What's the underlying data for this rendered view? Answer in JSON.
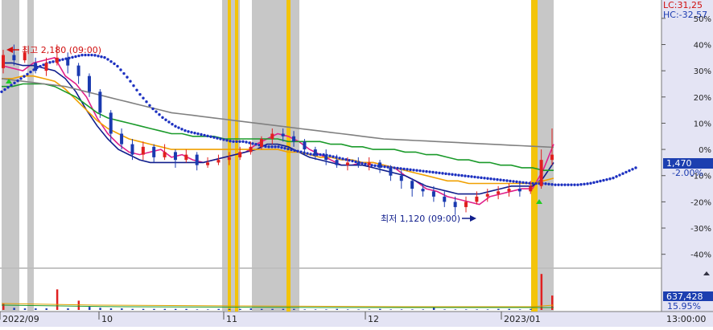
{
  "chart_data": {
    "type": "candlestick",
    "indicators": {
      "lc": "LC:31,25",
      "hc": "HC:-32,57"
    },
    "annotations": {
      "high": "최고 2,180 (09:00)",
      "low": "최저 1,120 (09:00)"
    },
    "y_axis": {
      "unit": "%",
      "ticks": [
        {
          "value": 50,
          "label": "50%"
        },
        {
          "value": 40,
          "label": "40%"
        },
        {
          "value": 30,
          "label": "30%"
        },
        {
          "value": 20,
          "label": "20%"
        },
        {
          "value": 10,
          "label": "10%"
        },
        {
          "value": 0,
          "label": "0%"
        },
        {
          "value": -10,
          "label": "-10%"
        },
        {
          "value": -20,
          "label": "-20%"
        },
        {
          "value": -30,
          "label": "-30%"
        },
        {
          "value": -40,
          "label": "-40%"
        }
      ],
      "range": [
        -45,
        57
      ]
    },
    "current_price": {
      "label": "1,470",
      "pct_label": "-2.00%",
      "pct": -2.0
    },
    "volume": {
      "label": "637,428",
      "pct_label": "15.95%"
    },
    "x_axis": {
      "labels": [
        "2022/09",
        "10",
        "11",
        "12",
        "2023/01"
      ],
      "time_label": "13:00:00"
    },
    "series": [
      {
        "name": "ma5",
        "color": "#e0208a",
        "values": [
          32,
          31,
          30,
          33,
          34,
          35,
          28,
          25,
          20,
          12,
          6,
          2,
          -1,
          -2,
          -1,
          0,
          -3,
          -2,
          -4,
          -5,
          -4,
          -3,
          -2,
          -1,
          2,
          4,
          6,
          5,
          3,
          0,
          -2,
          -4,
          -6,
          -6,
          -5,
          -5,
          -6,
          -7,
          -10,
          -12,
          -15,
          -16,
          -18,
          -19,
          -20,
          -21,
          -18,
          -17,
          -16,
          -15,
          -15,
          -8,
          2
        ]
      },
      {
        "name": "ma20",
        "color": "#101e8c",
        "values": [
          33,
          33,
          32,
          32,
          31,
          30,
          27,
          22,
          15,
          9,
          4,
          0,
          -2,
          -4,
          -5,
          -5,
          -5,
          -5,
          -5,
          -5,
          -4,
          -3,
          -2,
          -1,
          0,
          2,
          2,
          1,
          -1,
          -3,
          -4,
          -5,
          -6,
          -6,
          -6,
          -7,
          -8,
          -9,
          -10,
          -12,
          -14,
          -15,
          -16,
          -17,
          -17,
          -17,
          -16,
          -15,
          -14,
          -14,
          -14,
          -11,
          -5
        ]
      },
      {
        "name": "ma60",
        "color": "#f0a000",
        "values": [
          27,
          27,
          28,
          28,
          27,
          26,
          23,
          19,
          15,
          11,
          8,
          6,
          4,
          3,
          2,
          1,
          0,
          0,
          0,
          0,
          0,
          0,
          0,
          0,
          0,
          0,
          0,
          -1,
          -1,
          -2,
          -3,
          -3,
          -4,
          -4,
          -5,
          -5,
          -6,
          -7,
          -8,
          -9,
          -10,
          -11,
          -12,
          -12,
          -13,
          -13,
          -13,
          -13,
          -13,
          -13,
          -13,
          -12,
          -11
        ]
      },
      {
        "name": "ma120",
        "color": "#1a9a2a",
        "values": [
          24,
          24,
          25,
          25,
          25,
          24,
          22,
          20,
          17,
          14,
          12,
          11,
          10,
          9,
          8,
          7,
          6,
          6,
          5,
          5,
          5,
          4,
          4,
          4,
          4,
          4,
          4,
          3,
          3,
          3,
          3,
          2,
          2,
          1,
          1,
          0,
          0,
          0,
          -1,
          -1,
          -2,
          -2,
          -3,
          -4,
          -4,
          -5,
          -5,
          -6,
          -6,
          -7,
          -7,
          -8,
          -8
        ]
      },
      {
        "name": "ma240",
        "color": "#808080",
        "values": [
          27,
          26.5,
          26,
          25.5,
          25,
          24.5,
          24,
          23,
          22,
          21,
          20,
          19,
          18,
          17,
          16,
          15,
          14,
          13.5,
          13,
          12.5,
          12,
          11.5,
          11,
          10.5,
          10,
          9.5,
          9,
          8.5,
          8,
          7.5,
          7,
          6.5,
          6,
          5.5,
          5,
          4.5,
          4,
          3.8,
          3.6,
          3.4,
          3.2,
          3,
          2.8,
          2.6,
          2.4,
          2.2,
          2,
          1.8,
          1.6,
          1.4,
          1.2,
          1,
          0.8
        ]
      },
      {
        "name": "trend",
        "color": "#1b2fc0",
        "values": [
          22,
          25,
          28,
          31,
          33,
          34,
          35,
          36,
          36,
          35,
          32,
          27,
          21,
          16,
          12,
          9,
          7,
          6,
          5,
          4,
          3,
          3,
          2,
          1,
          1,
          0,
          -1,
          -2,
          -2,
          -3,
          -4,
          -5,
          -6,
          -6.5,
          -7,
          -7.5,
          -8,
          -8.5,
          -9,
          -9.5,
          -10,
          -10.5,
          -11,
          -11.5,
          -12,
          -12.5,
          -13,
          -13,
          -13.5,
          -13.5,
          -13.5,
          -13,
          -12,
          -11,
          -9,
          -7
        ]
      }
    ],
    "candles": [
      {
        "o": 31,
        "c": 36,
        "h": 38,
        "l": 29
      },
      {
        "o": 36,
        "c": 34,
        "h": 40,
        "l": 32
      },
      {
        "o": 34,
        "c": 37,
        "h": 39,
        "l": 33
      },
      {
        "o": 33,
        "c": 30,
        "h": 35,
        "l": 29
      },
      {
        "o": 30,
        "c": 33,
        "h": 35,
        "l": 28
      },
      {
        "o": 33,
        "c": 35,
        "h": 40,
        "l": 32
      },
      {
        "o": 35,
        "c": 32,
        "h": 37,
        "l": 29
      },
      {
        "o": 32,
        "c": 28,
        "h": 33,
        "l": 25
      },
      {
        "o": 28,
        "c": 22,
        "h": 29,
        "l": 20
      },
      {
        "o": 22,
        "c": 14,
        "h": 23,
        "l": 12
      },
      {
        "o": 14,
        "c": 6,
        "h": 15,
        "l": 3
      },
      {
        "o": 6,
        "c": 2,
        "h": 8,
        "l": 0
      },
      {
        "o": 2,
        "c": -2,
        "h": 4,
        "l": -4
      },
      {
        "o": -2,
        "c": 1,
        "h": 3,
        "l": -4
      },
      {
        "o": 1,
        "c": -3,
        "h": 2,
        "l": -5
      },
      {
        "o": -3,
        "c": -1,
        "h": 2,
        "l": -4
      },
      {
        "o": -1,
        "c": -4,
        "h": 0,
        "l": -7
      },
      {
        "o": -4,
        "c": -2,
        "h": 0,
        "l": -5
      },
      {
        "o": -2,
        "c": -6,
        "h": -1,
        "l": -8
      },
      {
        "o": -6,
        "c": -5,
        "h": -3,
        "l": -7
      },
      {
        "o": -5,
        "c": -4,
        "h": -2,
        "l": -6
      },
      {
        "o": -4,
        "c": -3,
        "h": -1,
        "l": -6
      },
      {
        "o": -3,
        "c": -1,
        "h": 1,
        "l": -4
      },
      {
        "o": -1,
        "c": 1,
        "h": 3,
        "l": -2
      },
      {
        "o": 1,
        "c": 4,
        "h": 5,
        "l": 0
      },
      {
        "o": 4,
        "c": 6,
        "h": 8,
        "l": 2
      },
      {
        "o": 6,
        "c": 5,
        "h": 8,
        "l": 3
      },
      {
        "o": 5,
        "c": 3,
        "h": 7,
        "l": 1
      },
      {
        "o": 3,
        "c": 0,
        "h": 4,
        "l": -2
      },
      {
        "o": 0,
        "c": -2,
        "h": 1,
        "l": -4
      },
      {
        "o": -2,
        "c": -4,
        "h": 0,
        "l": -6
      },
      {
        "o": -4,
        "c": -6,
        "h": -2,
        "l": -7
      },
      {
        "o": -6,
        "c": -5,
        "h": -3,
        "l": -8
      },
      {
        "o": -5,
        "c": -6,
        "h": -3,
        "l": -7
      },
      {
        "o": -6,
        "c": -5,
        "h": -3,
        "l": -8
      },
      {
        "o": -5,
        "c": -7,
        "h": -4,
        "l": -9
      },
      {
        "o": -7,
        "c": -10,
        "h": -6,
        "l": -12
      },
      {
        "o": -10,
        "c": -12,
        "h": -8,
        "l": -15
      },
      {
        "o": -12,
        "c": -15,
        "h": -11,
        "l": -18
      },
      {
        "o": -15,
        "c": -16,
        "h": -13,
        "l": -18
      },
      {
        "o": -16,
        "c": -18,
        "h": -14,
        "l": -20
      },
      {
        "o": -18,
        "c": -20,
        "h": -16,
        "l": -22
      },
      {
        "o": -20,
        "c": -22,
        "h": -18,
        "l": -25
      },
      {
        "o": -22,
        "c": -20,
        "h": -18,
        "l": -24
      },
      {
        "o": -20,
        "c": -18,
        "h": -16,
        "l": -21
      },
      {
        "o": -18,
        "c": -17,
        "h": -15,
        "l": -20
      },
      {
        "o": -17,
        "c": -16,
        "h": -14,
        "l": -19
      },
      {
        "o": -16,
        "c": -15,
        "h": -13,
        "l": -18
      },
      {
        "o": -15,
        "c": -16,
        "h": -13,
        "l": -18
      },
      {
        "o": -16,
        "c": -14,
        "h": -12,
        "l": -17
      },
      {
        "o": -14,
        "c": -4,
        "h": 0,
        "l": -15
      },
      {
        "o": -4,
        "c": -2,
        "h": 8,
        "l": -6
      }
    ],
    "volume_bars": [
      12,
      4,
      3,
      3,
      3,
      40,
      3,
      18,
      6,
      4,
      3,
      3,
      2,
      2,
      2,
      2,
      2,
      2,
      1,
      1,
      2,
      2,
      2,
      3,
      2,
      2,
      2,
      2,
      1,
      1,
      1,
      2,
      1,
      1,
      1,
      2,
      1,
      1,
      1,
      1,
      4,
      1,
      1,
      1,
      1,
      1,
      2,
      2,
      1,
      2,
      70,
      28
    ]
  }
}
